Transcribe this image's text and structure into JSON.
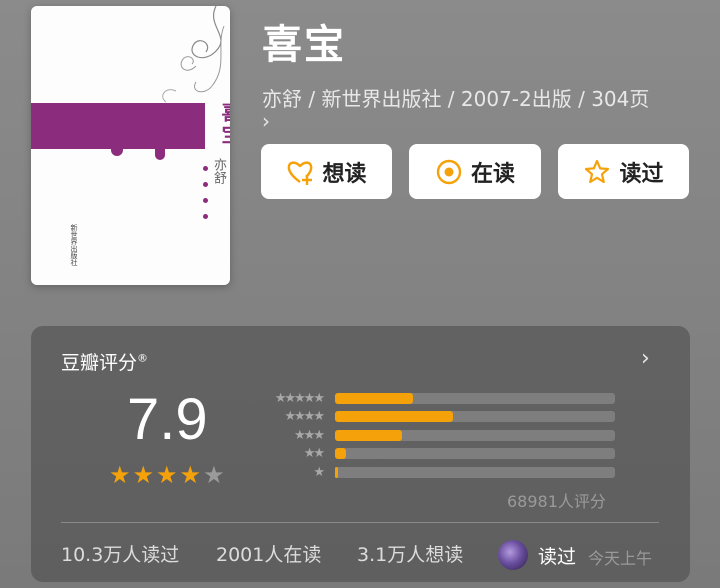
{
  "book": {
    "title": "喜宝",
    "meta": "亦舒 / 新世界出版社 / 2007-2出版 / 304页",
    "more_icon": "chevron-right-icon",
    "cover": {
      "title": "喜宝",
      "author": "亦舒",
      "publisher": "新世界出版社"
    }
  },
  "actions": [
    {
      "label": "想读",
      "icon": "heart-plus-icon"
    },
    {
      "label": "在读",
      "icon": "target-icon"
    },
    {
      "label": "读过",
      "icon": "star-outline-icon"
    }
  ],
  "rating": {
    "heading": "豆瓣评分",
    "registered_mark": "®",
    "score": "7.9",
    "stars": 4,
    "distribution": [
      {
        "stars": "★★★★★",
        "fraction": 0.28
      },
      {
        "stars": "★★★★",
        "fraction": 0.42
      },
      {
        "stars": "★★★",
        "fraction": 0.24
      },
      {
        "stars": "★★",
        "fraction": 0.04
      },
      {
        "stars": "★",
        "fraction": 0.01
      }
    ],
    "count_label": "68981人评分"
  },
  "stats": {
    "read": "10.3万人读过",
    "reading": "2001人在读",
    "want": "3.1万人想读"
  },
  "friend": {
    "status": "读过",
    "time": "今天上午"
  },
  "colors": {
    "accent": "#f5a20a",
    "star": "#f5a20a",
    "star_empty": "#9a9a9a",
    "cover_band": "#8c2c7d"
  }
}
